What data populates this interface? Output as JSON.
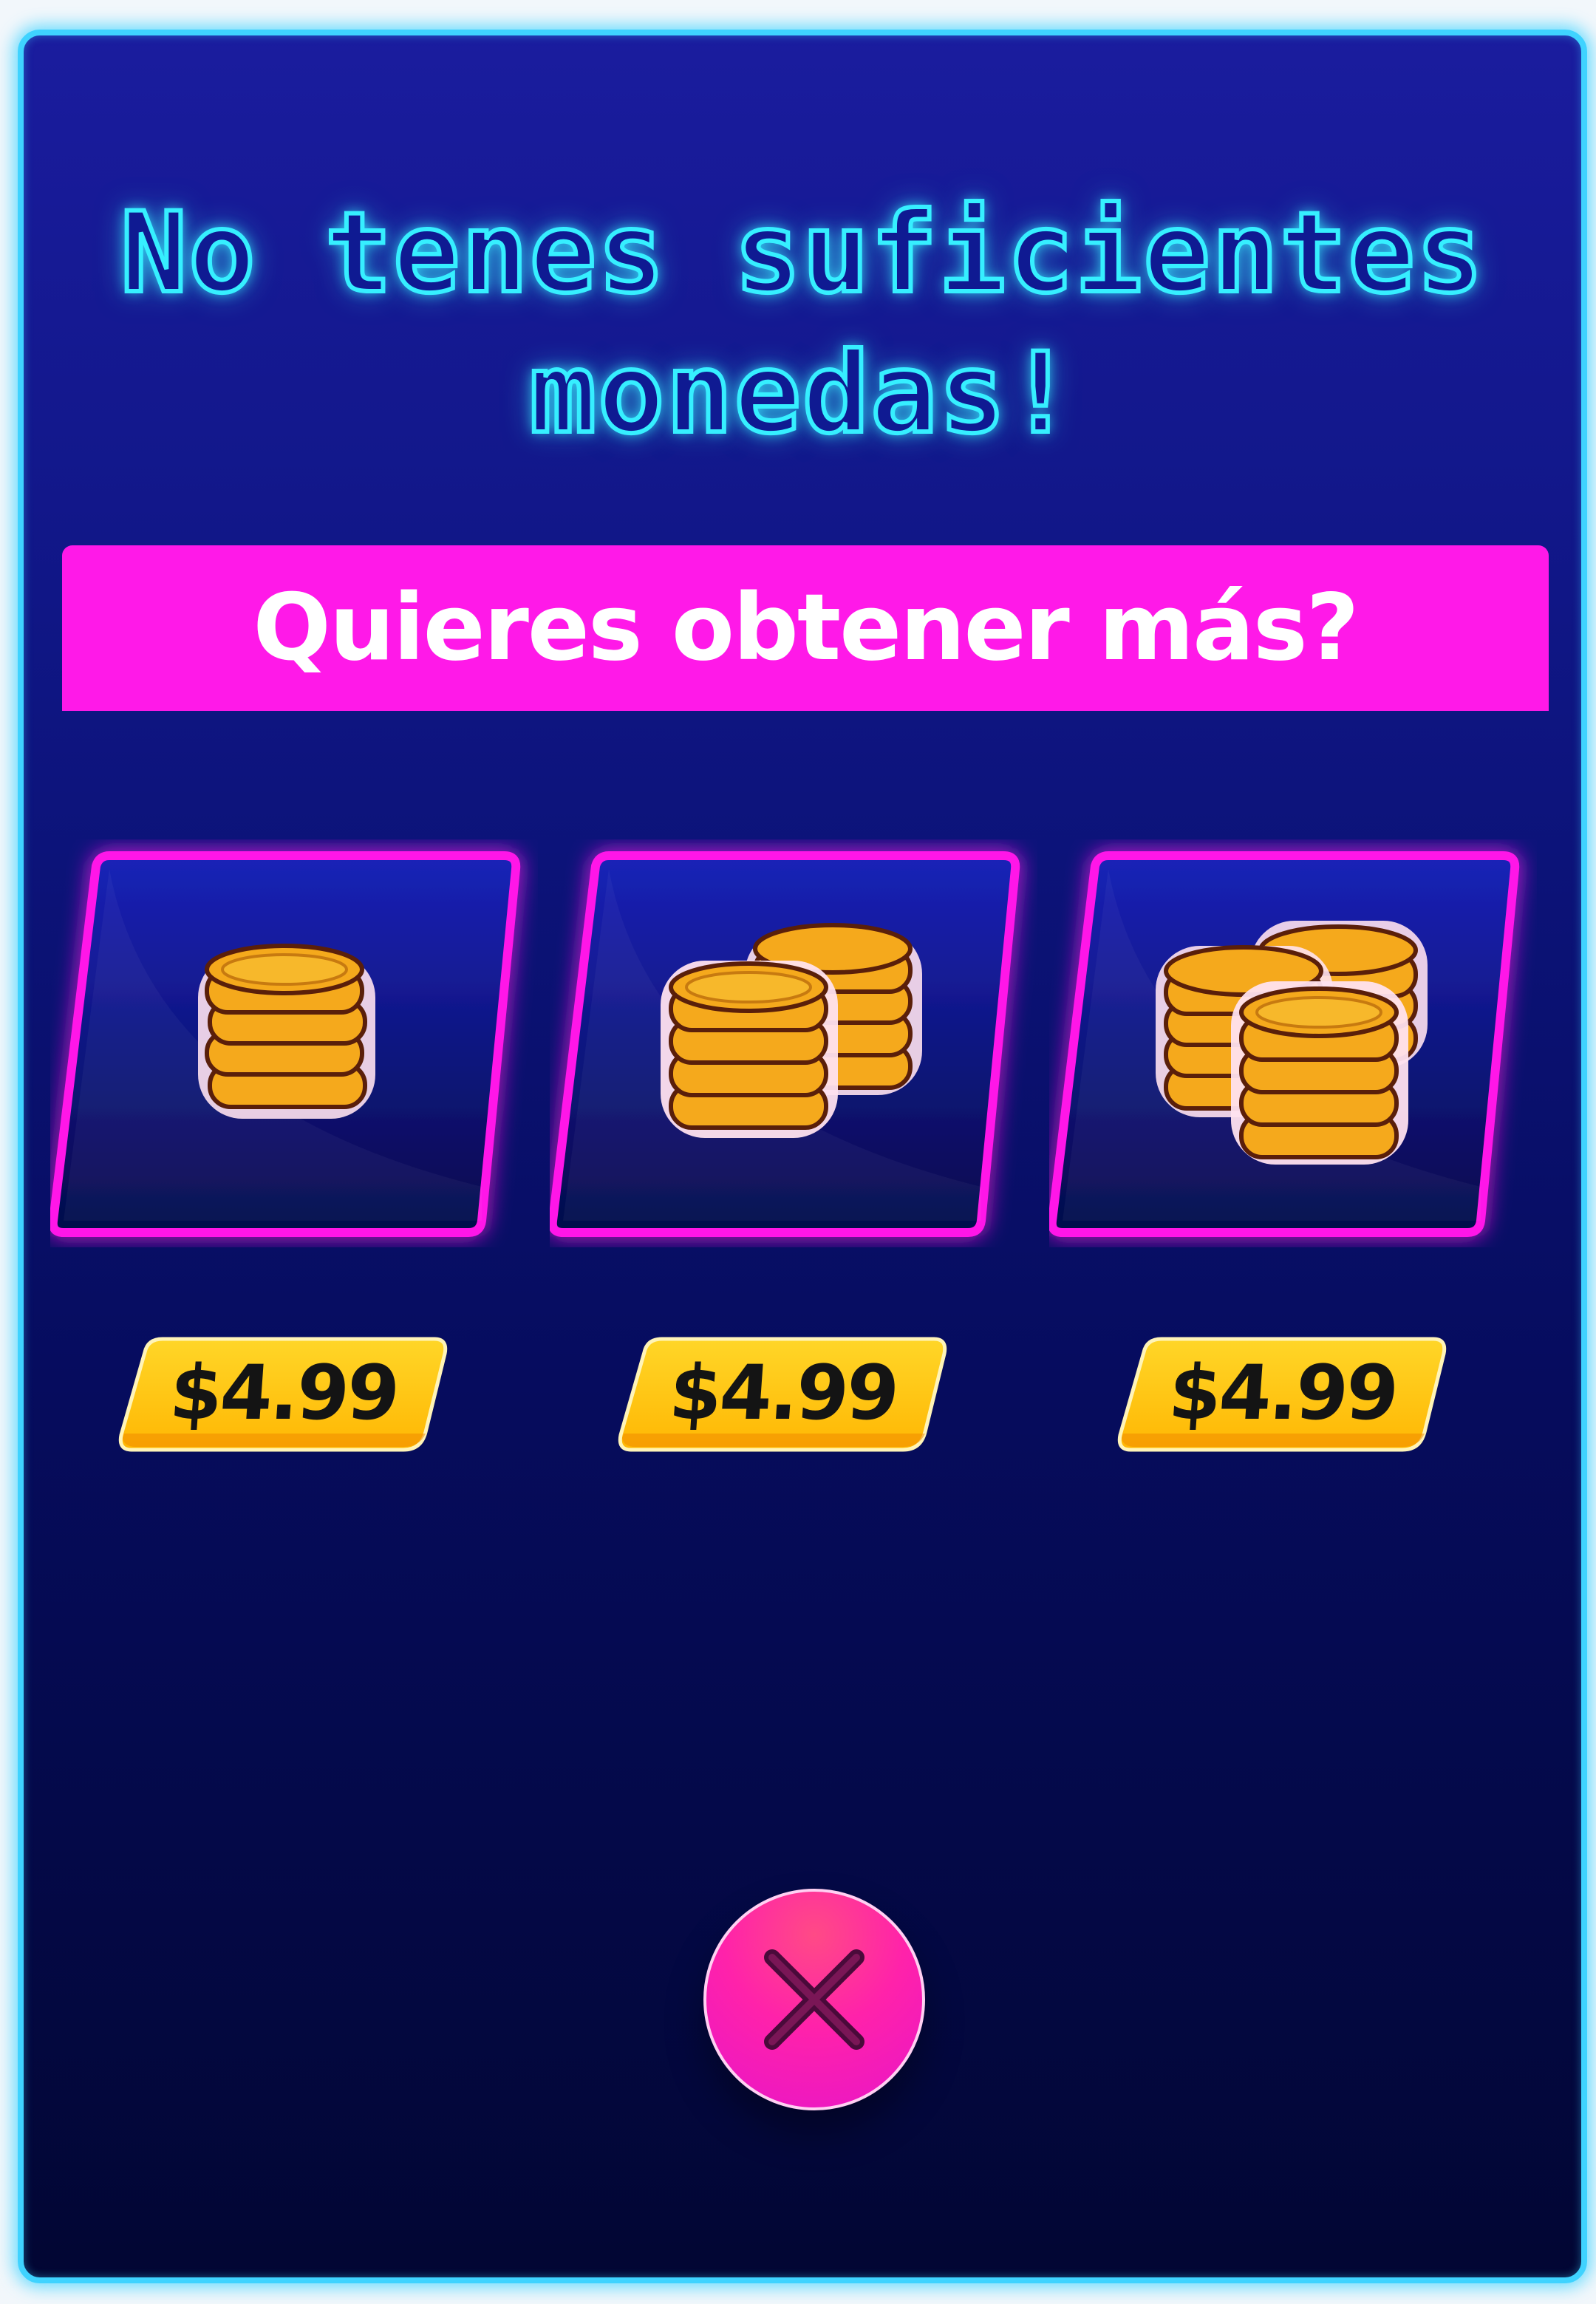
{
  "dialog": {
    "title_line1": "No tenes suficientes",
    "title_line2": "monedas!",
    "subtitle": "Quieres obtener más?"
  },
  "offers": [
    {
      "price": "$4.99",
      "icon": "coin-stack-small-icon"
    },
    {
      "price": "$4.99",
      "icon": "coin-stack-medium-icon"
    },
    {
      "price": "$4.99",
      "icon": "coin-stack-large-icon"
    }
  ],
  "close_button": {
    "icon": "close-icon"
  },
  "colors": {
    "panel_border": "#3fd3ff",
    "title_glow": "#36efff",
    "subtitle_bar": "#ff19e8",
    "card_border": "#ff19e8",
    "price_button": "#ffc815",
    "coin": "#f5a91c",
    "close_button": "#ff22aa"
  }
}
